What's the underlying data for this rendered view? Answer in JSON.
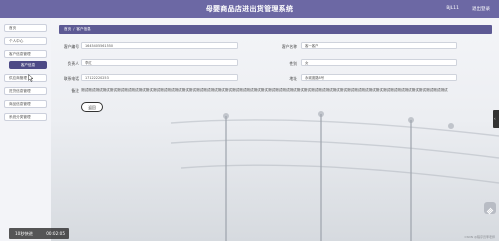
{
  "header": {
    "title": "母婴商品店进出货管理系统",
    "user": "BJL11",
    "logout": "退出登录"
  },
  "sidebar": {
    "items": [
      {
        "label": "首页"
      },
      {
        "label": "个人中心"
      },
      {
        "label": "客户信息管理"
      },
      {
        "label": "客户信息"
      },
      {
        "label": "供应商管理"
      },
      {
        "label": "进货信息管理"
      },
      {
        "label": "商品信息管理"
      },
      {
        "label": "系统分类管理"
      }
    ]
  },
  "breadcrumb": {
    "home": "首页",
    "sep": "/",
    "current": "客户信息"
  },
  "form": {
    "customer_id": {
      "label": "客户编号",
      "value": "1645405561550"
    },
    "customer_name": {
      "label": "客户名称",
      "value": "客一客户"
    },
    "contact": {
      "label": "负责人",
      "value": "李红"
    },
    "gender": {
      "label": "性别",
      "value": "女"
    },
    "phone": {
      "label": "联系电话",
      "value": "17122220253"
    },
    "address": {
      "label": "地址",
      "value": "永城澳路8号"
    },
    "remark": {
      "label": "备注",
      "value": "测试测试测试测试测试测试测试测试测试测试测试测试测试测试测试测试测试测试测试测试测试测试测试测试测试测试测试测试测试测试测试测试测试测试测试测试测试测试测试测试测试测试测试测试测试测试测试测试测试测试测试"
    }
  },
  "back_button": "返回",
  "video": {
    "speed": "10秒快进",
    "time": "00:02:05"
  },
  "right_tab_glyph": "‹",
  "watermark": "CSDN @程序员李老师"
}
